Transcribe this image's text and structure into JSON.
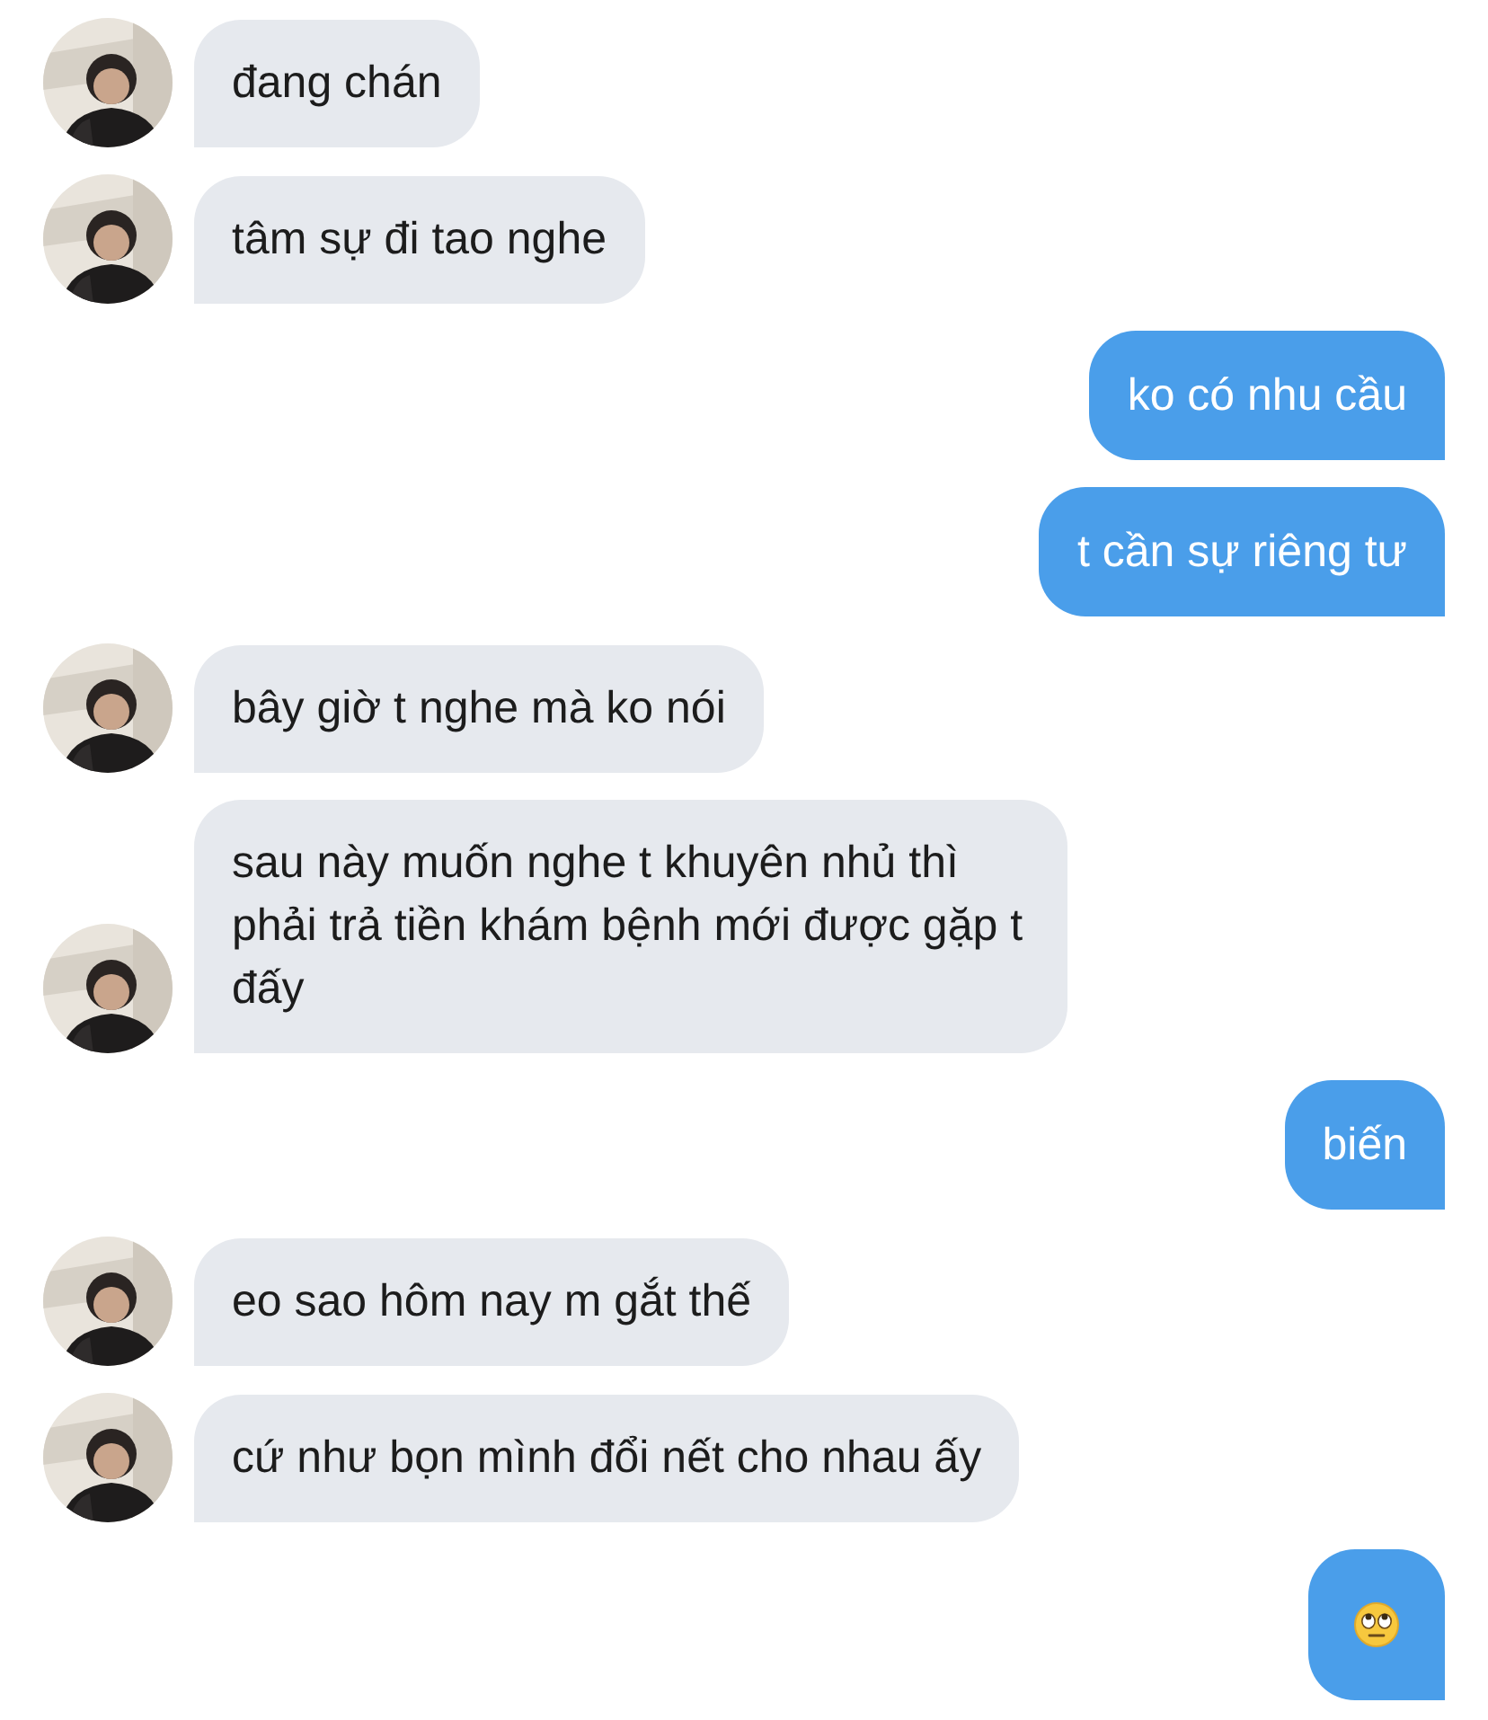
{
  "messages": [
    {
      "kind": "text",
      "outgoing": false,
      "text": "đang chán"
    },
    {
      "kind": "text",
      "outgoing": false,
      "text": "tâm sự đi tao nghe"
    },
    {
      "kind": "text",
      "outgoing": true,
      "text": "ko có nhu cầu"
    },
    {
      "kind": "text",
      "outgoing": true,
      "text": "t cần sự riêng tư"
    },
    {
      "kind": "text",
      "outgoing": false,
      "text": "bây giờ t nghe mà ko nói"
    },
    {
      "kind": "text",
      "outgoing": false,
      "text": "sau này muốn nghe t khuyên nhủ thì phải trả tiền khám bệnh mới được gặp t đấy"
    },
    {
      "kind": "text",
      "outgoing": true,
      "text": "biến"
    },
    {
      "kind": "text",
      "outgoing": false,
      "text": "eo sao hôm nay m gắt thế"
    },
    {
      "kind": "text",
      "outgoing": false,
      "text": "cứ như bọn mình đổi nết cho nhau ấy"
    },
    {
      "kind": "emoji",
      "outgoing": true
    }
  ]
}
